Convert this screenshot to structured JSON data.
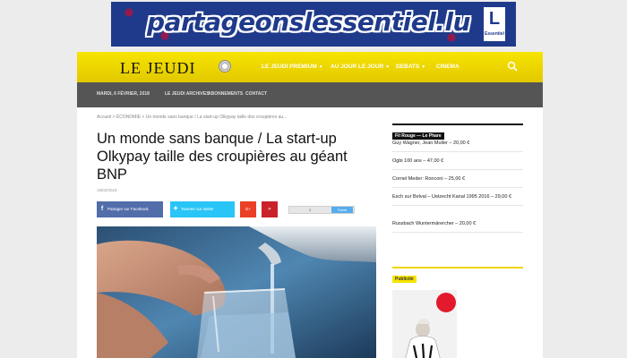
{
  "banner": {
    "wordmark": "partageonslessentiel.lu",
    "badge_letter": "L",
    "badge_small": "Essentiel"
  },
  "nav": {
    "logo": "LE JEUDI",
    "items": [
      {
        "label": "LE JEUDI PREMIUM",
        "has_caret": true
      },
      {
        "label": "AU JOUR LE JOUR",
        "has_caret": true
      },
      {
        "label": "DEBATS",
        "has_caret": true
      },
      {
        "label": "CINEMA",
        "has_caret": false
      }
    ],
    "search_icon": "search-icon"
  },
  "subbar": {
    "date": "MARDI, 6 FÉVRIER, 2018",
    "items": [
      "LE JEUDI ARCHIVES",
      "ABONNEMENTS",
      "CONTACT"
    ]
  },
  "article": {
    "breadcrumb": "Accueil  >  ÉCONOMIE  >  Un monde sans banque / La start-up Olkypay taille des croupières au...",
    "headline": "Un monde sans banque / La start-up Olkypay taille des croupières au géant BNP",
    "date": "19/02/2018",
    "share": {
      "facebook": "Partager sur Facebook",
      "twitter": "Tweeter sur twitter",
      "gplus": "G+",
      "pinterest": "P",
      "tweet_count": "0",
      "tweet_button": "Tweet"
    }
  },
  "sidebar": {
    "title": "Fil Rouge — Le Phare",
    "items": [
      "Guy Wagner, Jean Muller – 20,00 €",
      "Ogbi 100 ans – 47,00 €",
      "Cornel Meder: Ronconi – 25,00 €",
      "Esch sur Belval – Uelzecht Kanal 1995 2016 – 29,00 €",
      "Russbach Wuntermärercher – 20,00 €"
    ],
    "ad_title": "Publicité"
  },
  "colors": {
    "nav_yellow": "#f2dc00",
    "subbar_grey": "#555555",
    "facebook": "#516eab",
    "twitter": "#29c5f6",
    "banner_blue": "#1f3a8a"
  }
}
